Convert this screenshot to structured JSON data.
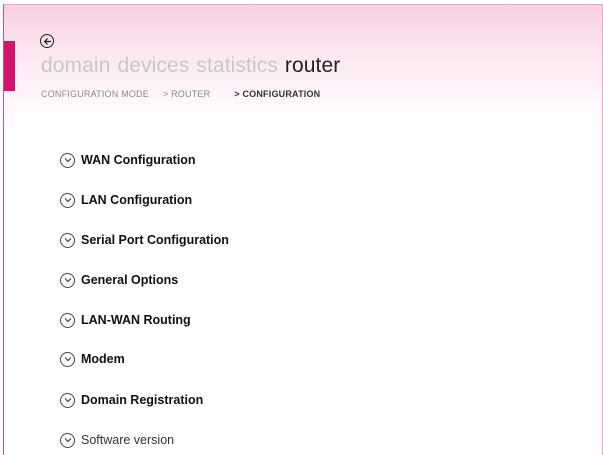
{
  "header": {
    "nav_items": [
      {
        "label": "domain",
        "active": false
      },
      {
        "label": "devices",
        "active": false
      },
      {
        "label": "statistics",
        "active": false
      },
      {
        "label": "router",
        "active": true
      }
    ],
    "breadcrumb": {
      "item1": "CONFIGURATION MODE",
      "item2": "> ROUTER",
      "item3": "> CONFIGURATION"
    },
    "back_icon": "back-arrow-circle-icon"
  },
  "sections": [
    {
      "label": "WAN Configuration",
      "expanded": false
    },
    {
      "label": "LAN Configuration",
      "expanded": false
    },
    {
      "label": "Serial Port Configuration",
      "expanded": false
    },
    {
      "label": "General Options",
      "expanded": false
    },
    {
      "label": "LAN-WAN Routing",
      "expanded": false
    },
    {
      "label": "Modem",
      "expanded": false
    },
    {
      "label": "Domain Registration",
      "expanded": false
    },
    {
      "label": "Software version",
      "expanded": false
    }
  ],
  "colors": {
    "accent": "#d4136d",
    "header_gradient_top": "#f7cfe1",
    "inactive_nav": "#c8c8c8",
    "active_nav": "#222222"
  }
}
